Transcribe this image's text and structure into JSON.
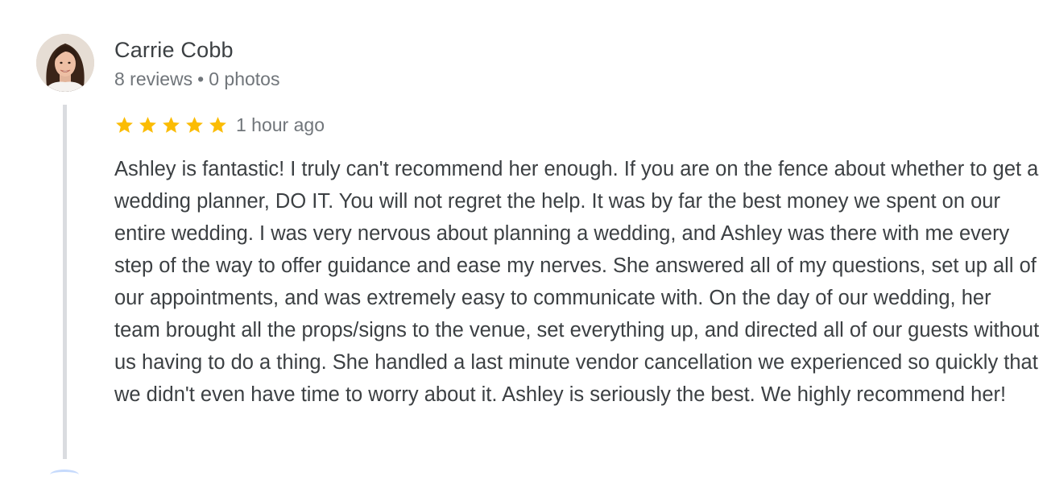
{
  "review": {
    "reviewer_name": "Carrie Cobb",
    "reviews_count": "8 reviews",
    "separator": "•",
    "photos_count": "0 photos",
    "rating": 5,
    "max_rating": 5,
    "time_ago": "1 hour ago",
    "text": "Ashley is fantastic! I truly can't recommend her enough. If you are on the fence about whether to get a wedding planner, DO IT. You will not regret the help. It was by far the best money we spent on our entire wedding. I was very nervous about planning a wedding, and Ashley was there with me every step of the way to offer guidance and ease my nerves. She answered all of my questions, set up all of our appointments, and was extremely easy to communicate with. On the day of our wedding, her team brought all the props/signs to the venue, set everything up, and directed all of our guests without us having to do a thing. She handled a last minute vendor cancellation we experienced so quickly that we didn't even have time to worry about it. Ashley is seriously the best. We highly recommend her!"
  },
  "colors": {
    "star": "#fbbc04",
    "primary_text": "#3c4043",
    "secondary_text": "#70757a",
    "thread_line": "#dadce0"
  },
  "icons": {
    "star": "star-icon",
    "avatar": "reviewer-avatar"
  }
}
